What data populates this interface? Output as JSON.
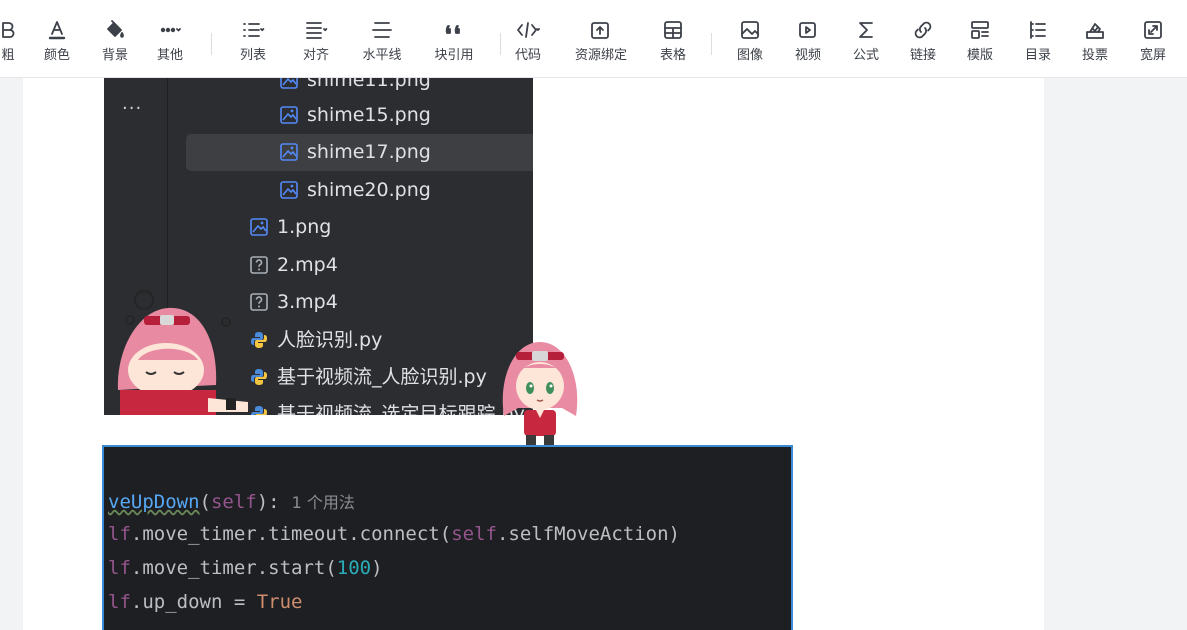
{
  "toolbar": {
    "items": [
      {
        "label": "粗",
        "icon": "bold-icon"
      },
      {
        "label": "颜色",
        "icon": "font-color-icon"
      },
      {
        "label": "背景",
        "icon": "paint-bucket-icon"
      },
      {
        "label": "其他",
        "icon": "more-icon"
      },
      {
        "label": "列表",
        "icon": "list-icon"
      },
      {
        "label": "对齐",
        "icon": "align-icon"
      },
      {
        "label": "水平线",
        "icon": "horizontal-rule-icon"
      },
      {
        "label": "块引用",
        "icon": "blockquote-icon"
      },
      {
        "label": "代码",
        "icon": "code-icon"
      },
      {
        "label": "资源绑定",
        "icon": "resource-bind-icon"
      },
      {
        "label": "表格",
        "icon": "table-icon"
      },
      {
        "label": "图像",
        "icon": "image-icon"
      },
      {
        "label": "视频",
        "icon": "video-icon"
      },
      {
        "label": "公式",
        "icon": "sigma-icon"
      },
      {
        "label": "链接",
        "icon": "link-icon"
      },
      {
        "label": "模版",
        "icon": "template-icon"
      },
      {
        "label": "目录",
        "icon": "toc-icon"
      },
      {
        "label": "投票",
        "icon": "vote-icon"
      },
      {
        "label": "宽屏",
        "icon": "widescreen-icon"
      }
    ]
  },
  "ide": {
    "files": [
      {
        "name": "shime11.png",
        "type": "image"
      },
      {
        "name": "shime15.png",
        "type": "image"
      },
      {
        "name": "shime17.png",
        "type": "image",
        "selected": true
      },
      {
        "name": "shime20.png",
        "type": "image"
      },
      {
        "name": "1.png",
        "type": "image"
      },
      {
        "name": "2.mp4",
        "type": "unknown"
      },
      {
        "name": "3.mp4",
        "type": "unknown"
      },
      {
        "name": "人脸识别.py",
        "type": "python"
      },
      {
        "name": "基于视频流_人脸识别.py",
        "type": "python"
      },
      {
        "name": "基于视频流_选定目标跟踪.py",
        "type": "python"
      }
    ],
    "more_dots": "···"
  },
  "code": {
    "line1": {
      "fn": "veUpDown",
      "open": "(",
      "self": "self",
      "close": "):",
      "hint": "1 个用法"
    },
    "line2": {
      "pre": "lf",
      "rest": ".move_timer.timeout.connect(",
      "self": "self",
      "end": ".selfMoveAction)"
    },
    "line3": {
      "pre": "lf",
      "rest": ".move_timer.start(",
      "num": "100",
      "end": ")"
    },
    "line4": {
      "pre": "lf",
      "rest": ".up_down = ",
      "kw": "True"
    }
  },
  "colors": {
    "accent_border": "#3b8ad6",
    "ide_bg": "#2b2d30",
    "code_bg": "#1e1f22"
  }
}
